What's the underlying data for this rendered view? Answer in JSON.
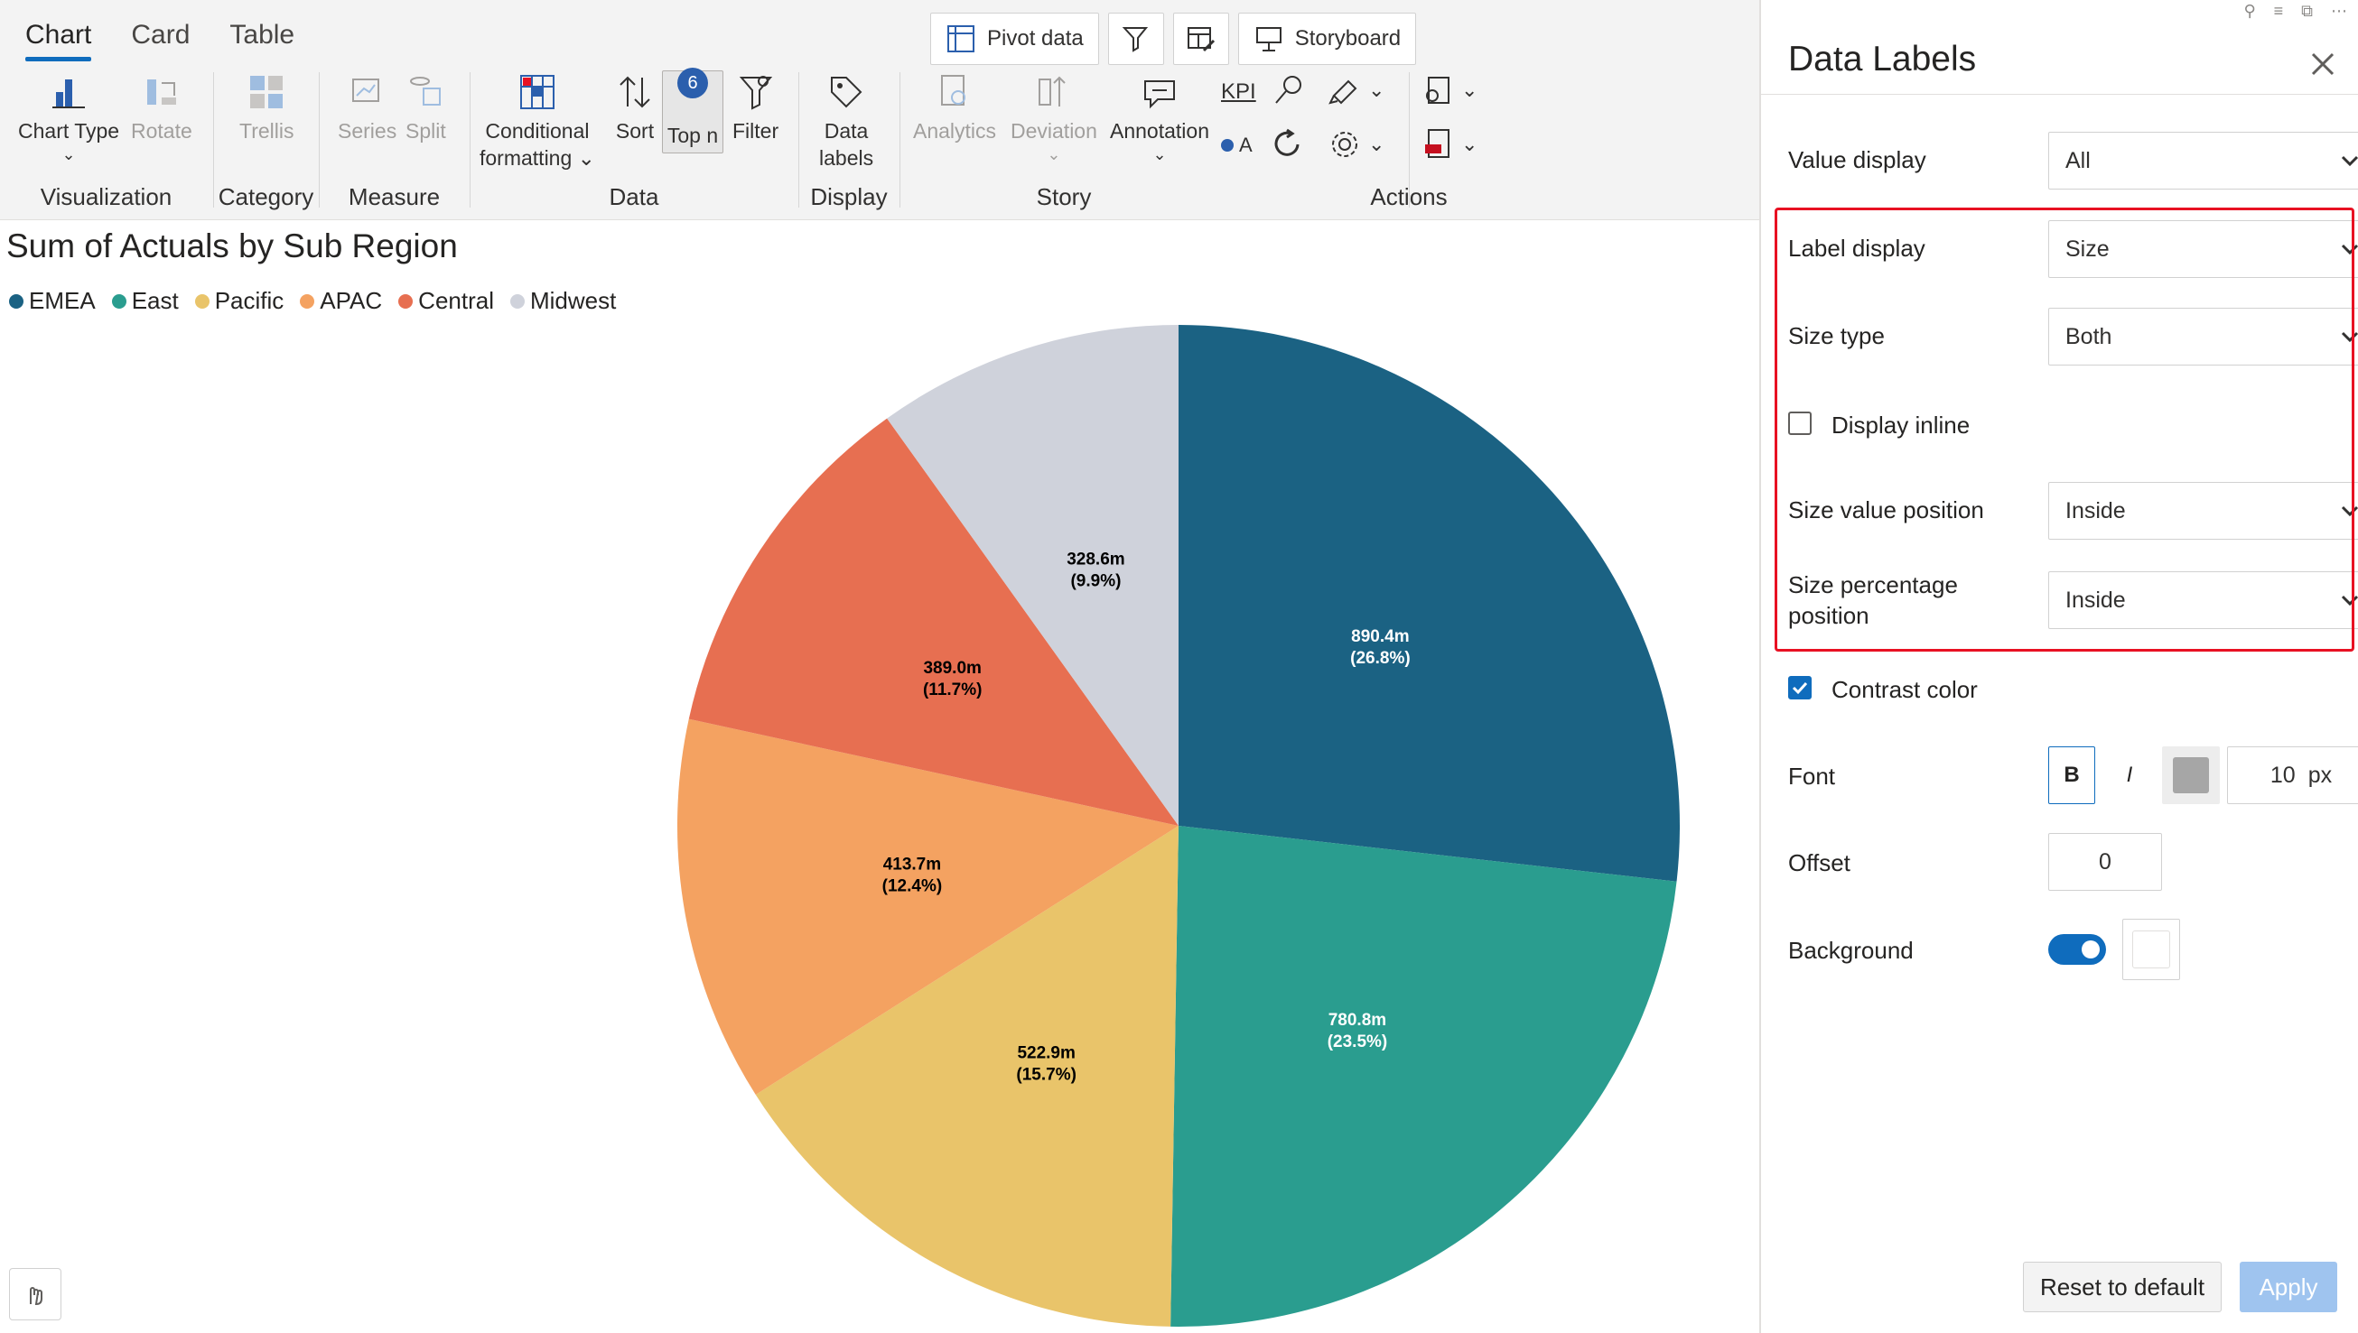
{
  "ribbon": {
    "tabs": [
      "Chart",
      "Card",
      "Table"
    ],
    "top_buttons": {
      "pivot": "Pivot data",
      "storyboard": "Storyboard"
    },
    "groups": {
      "visualization": "Visualization",
      "category": "Category",
      "measure": "Measure",
      "data": "Data",
      "display": "Display",
      "story": "Story",
      "actions": "Actions"
    },
    "buttons": {
      "chart_type": "Chart Type",
      "rotate": "Rotate",
      "trellis": "Trellis",
      "series": "Series",
      "split": "Split",
      "conditional_1": "Conditional",
      "conditional_2": "formatting",
      "sort": "Sort",
      "topn": "Top n",
      "topn_badge": "6",
      "filter": "Filter",
      "data_labels_1": "Data",
      "data_labels_2": "labels",
      "analytics": "Analytics",
      "deviation": "Deviation",
      "annotation": "Annotation",
      "kpi": "KPI",
      "kpi_a": "A"
    }
  },
  "chart": {
    "title_bold": "Sum of Actuals",
    "title_rest": " by Sub Region"
  },
  "chart_data": {
    "type": "pie",
    "title": "Sum of Actuals by Sub Region",
    "categories": [
      "EMEA",
      "East",
      "Pacific",
      "APAC",
      "Central",
      "Midwest"
    ],
    "values": [
      890.4,
      780.8,
      522.9,
      413.7,
      389.0,
      328.6
    ],
    "value_labels": [
      "890.4m",
      "780.8m",
      "522.9m",
      "413.7m",
      "389.0m",
      "328.6m"
    ],
    "percent_labels": [
      "(26.8%)",
      "(23.5%)",
      "(15.7%)",
      "(12.4%)",
      "(11.7%)",
      "(9.9%)"
    ],
    "colors": [
      "#1b6283",
      "#2a9d8f",
      "#e9c46a",
      "#f4a261",
      "#e76f51",
      "#cfd2db"
    ],
    "legend_position": "top-left"
  },
  "panel": {
    "title": "Data Labels",
    "value_display_label": "Value display",
    "value_display": "All",
    "label_display_label": "Label display",
    "label_display": "Size",
    "size_type_label": "Size type",
    "size_type": "Both",
    "display_inline_label": "Display inline",
    "size_value_position_label": "Size value position",
    "size_value_position": "Inside",
    "size_percentage_position_label_1": "Size percentage",
    "size_percentage_position_label_2": "position",
    "size_percentage_position": "Inside",
    "contrast_color_label": "Contrast color",
    "font_label": "Font",
    "font_bold": "B",
    "font_italic": "I",
    "font_size": "10",
    "font_unit": "px",
    "offset_label": "Offset",
    "offset": "0",
    "background_label": "Background",
    "reset": "Reset to default",
    "apply": "Apply"
  }
}
